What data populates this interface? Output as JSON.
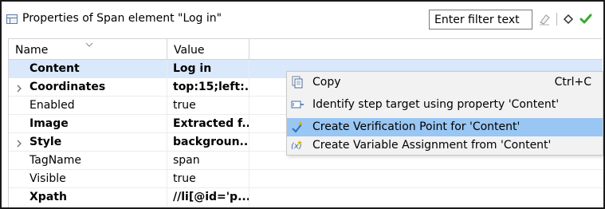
{
  "header": {
    "title": "Properties of Span element \"Log in\"",
    "filter_placeholder": "Enter filter text",
    "icons": [
      "table-icon",
      "clear-filter-icon",
      "diamond-icon",
      "check-icon"
    ]
  },
  "table": {
    "columns": [
      "Name",
      "Value"
    ],
    "rows": [
      {
        "name": "Content",
        "value": "Log in",
        "bold": true,
        "expandable": false,
        "selected": true
      },
      {
        "name": "Coordinates",
        "value": "top:15;left:...",
        "bold": true,
        "expandable": true,
        "selected": false
      },
      {
        "name": "Enabled",
        "value": "true",
        "bold": false,
        "expandable": false,
        "selected": false
      },
      {
        "name": "Image",
        "value": "Extracted f...",
        "bold": true,
        "expandable": false,
        "selected": false
      },
      {
        "name": "Style",
        "value": "backgroun...",
        "bold": true,
        "expandable": true,
        "selected": false
      },
      {
        "name": "TagName",
        "value": "span",
        "bold": false,
        "expandable": false,
        "selected": false
      },
      {
        "name": "Visible",
        "value": "true",
        "bold": false,
        "expandable": false,
        "selected": false
      },
      {
        "name": "Xpath",
        "value": "//li[@id='p...",
        "bold": true,
        "expandable": false,
        "selected": false
      }
    ]
  },
  "context_menu": {
    "items": [
      {
        "label": "Copy",
        "accelerator": "Ctrl+C",
        "icon": "copy-icon",
        "highlighted": false
      },
      {
        "label": "Identify step target using property 'Content'",
        "accelerator": "",
        "icon": "target-icon",
        "highlighted": false
      },
      {
        "label": "Create Verification Point for 'Content'",
        "accelerator": "",
        "icon": "verification-point-icon",
        "highlighted": true
      },
      {
        "label": "Create Variable Assignment from 'Content'",
        "accelerator": "",
        "icon": "variable-icon",
        "highlighted": false
      }
    ]
  },
  "colors": {
    "selected_row": "#d9e8fb",
    "menu_highlight": "#99c6f3",
    "check_green": "#3aa832"
  }
}
